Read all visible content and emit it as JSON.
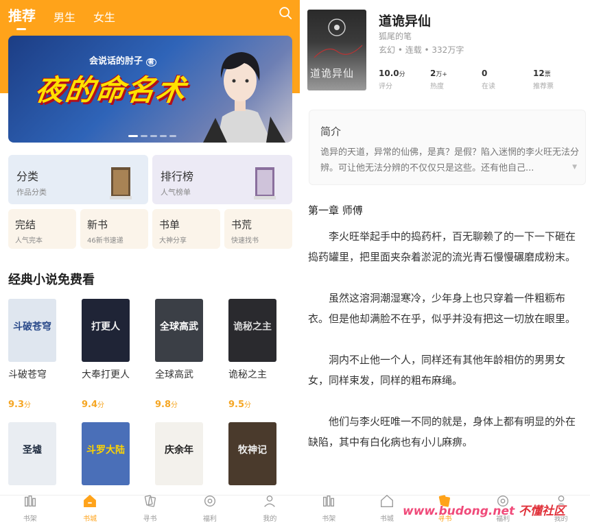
{
  "left": {
    "tabs": [
      {
        "label": "推荐",
        "active": true
      },
      {
        "label": "男生",
        "active": false
      },
      {
        "label": "女生",
        "active": false
      }
    ],
    "banner": {
      "subtitle": "会说话的肘子",
      "badge": "著",
      "title": "夜的命名术",
      "slide_count": 5,
      "active_slide": 1
    },
    "categories": [
      {
        "title": "分类",
        "subtitle": "作品分类"
      },
      {
        "title": "排行榜",
        "subtitle": "人气榜单"
      }
    ],
    "shortcuts": [
      {
        "title": "完结",
        "subtitle": "人气完本"
      },
      {
        "title": "新书",
        "subtitle": "46新书速递"
      },
      {
        "title": "书单",
        "subtitle": "大神分享"
      },
      {
        "title": "书荒",
        "subtitle": "快速找书"
      }
    ],
    "section_title": "经典小说免费看",
    "books": [
      {
        "name": "斗破苍穹",
        "score": "9.3",
        "unit": "分",
        "cover_text": "斗破苍穹",
        "cover_color": "#dfe6ef",
        "text_color": "#2a4a8a"
      },
      {
        "name": "大奉打更人",
        "score": "9.4",
        "unit": "分",
        "cover_text": "打更人",
        "cover_color": "#1f2436",
        "text_color": "#f2f2f2"
      },
      {
        "name": "全球高武",
        "score": "9.8",
        "unit": "分",
        "cover_text": "全球高武",
        "cover_color": "#3b3f46",
        "text_color": "#ffffff"
      },
      {
        "name": "诡秘之主",
        "score": "9.5",
        "unit": "分",
        "cover_text": "诡秘之主",
        "cover_color": "#2a2a2e",
        "text_color": "#d9d9d9"
      },
      {
        "name": "",
        "score": "",
        "unit": "",
        "cover_text": "圣墟",
        "cover_color": "#e9edf2",
        "text_color": "#1e2b3f"
      },
      {
        "name": "",
        "score": "",
        "unit": "",
        "cover_text": "斗罗大陆",
        "cover_color": "#4a6fb8",
        "text_color": "#ffd400"
      },
      {
        "name": "",
        "score": "",
        "unit": "",
        "cover_text": "庆余年",
        "cover_color": "#f3f1ec",
        "text_color": "#222222"
      },
      {
        "name": "",
        "score": "",
        "unit": "",
        "cover_text": "牧神记",
        "cover_color": "#4a3a2c",
        "text_color": "#eeeeee"
      }
    ],
    "nav": [
      {
        "label": "书架",
        "icon": "bookshelf-icon",
        "active": false
      },
      {
        "label": "书城",
        "icon": "home-icon",
        "active": true
      },
      {
        "label": "寻书",
        "icon": "cards-icon",
        "active": false
      },
      {
        "label": "福利",
        "icon": "gift-icon",
        "active": false
      },
      {
        "label": "我的",
        "icon": "profile-icon",
        "active": false
      }
    ]
  },
  "right": {
    "cover_title": "道诡异仙",
    "title": "道诡异仙",
    "author": "狐尾的笔",
    "meta": "玄幻 • 连载 • 332万字",
    "stats": [
      {
        "value": "10.0",
        "unit": "分",
        "label": "评分"
      },
      {
        "value": "2",
        "unit": "万+",
        "label": "热度"
      },
      {
        "value": "0",
        "unit": "",
        "label": "在读"
      },
      {
        "value": "12",
        "unit": "票",
        "label": "推荐票"
      }
    ],
    "intro_heading": "简介",
    "intro_text": "诡异的天道，异常的仙佛，是真？是假？陷入迷惘的李火旺无法分辨。可让他无法分辨的不仅仅只是这些。还有他自己...",
    "chapter_title": "第一章 师傅",
    "paragraphs": [
      "李火旺举起手中的捣药杆，百无聊赖了的一下一下砸在捣药罐里，把里面夹杂着淤泥的流光青石慢慢碾磨成粉末。",
      "虽然这溶洞潮湿寒冷，少年身上也只穿着一件粗粝布衣。但是他却满脸不在乎，似乎并没有把这一切放在眼里。",
      "洞内不止他一个人，同样还有其他年龄相仿的男男女女，同样束发，同样的粗布麻绳。",
      "他们与李火旺唯一不同的就是，身体上都有明显的外在缺陷，其中有白化病也有小儿麻痹。"
    ],
    "nav": [
      {
        "label": "书架",
        "icon": "bookshelf-icon",
        "active": false
      },
      {
        "label": "书城",
        "icon": "home-icon",
        "active": false
      },
      {
        "label": "寻书",
        "icon": "cards-icon",
        "active": true
      },
      {
        "label": "福利",
        "icon": "gift-icon",
        "active": false
      },
      {
        "label": "我的",
        "icon": "profile-icon",
        "active": false
      }
    ],
    "watermark_url": "www.budong.net",
    "watermark_name": "不懂社区"
  },
  "colors": {
    "accent": "#ffa31a",
    "score": "#f5a623"
  }
}
